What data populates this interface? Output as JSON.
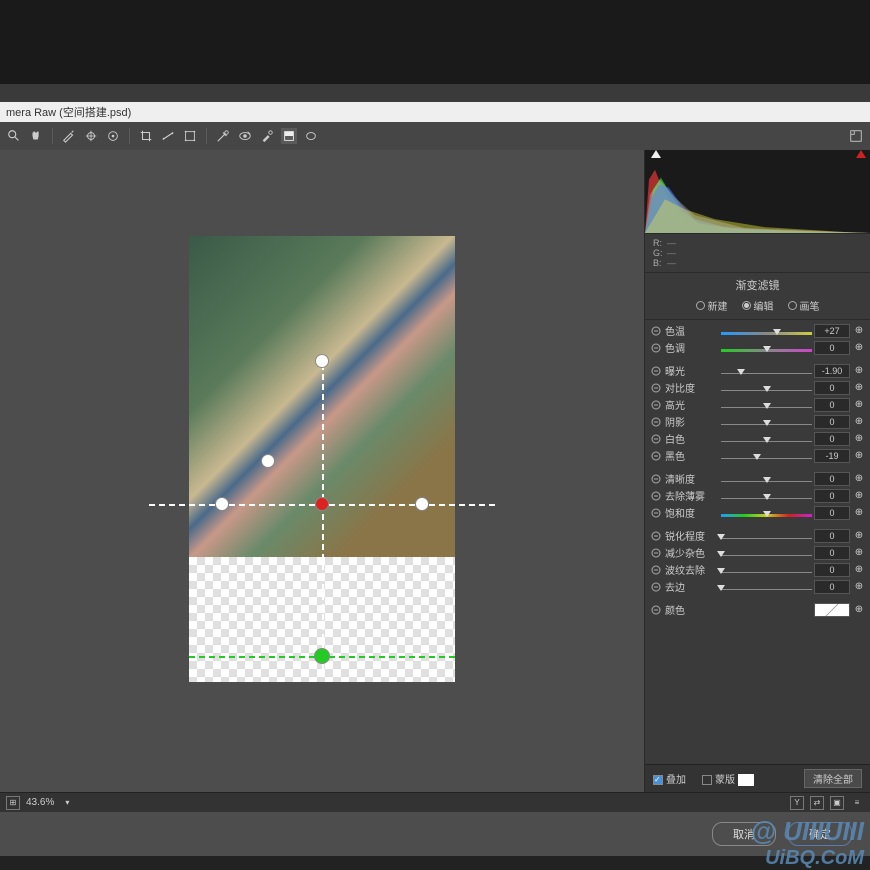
{
  "title": "mera Raw (空间搭建.psd)",
  "zoom_display": "43.6%",
  "rgb": {
    "r_label": "R:",
    "g_label": "G:",
    "b_label": "B:",
    "r": "—",
    "g": "—",
    "b": "—"
  },
  "panel_title": "渐变滤镜",
  "radios": {
    "new": "新建",
    "edit": "编辑",
    "brush": "画笔"
  },
  "sliders": {
    "temp": {
      "label": "色温",
      "value": "+27",
      "pos": 62
    },
    "tint": {
      "label": "色调",
      "value": "0",
      "pos": 50
    },
    "exposure": {
      "label": "曝光",
      "value": "-1.90",
      "pos": 22
    },
    "contrast": {
      "label": "对比度",
      "value": "0",
      "pos": 50
    },
    "highlights": {
      "label": "高光",
      "value": "0",
      "pos": 50
    },
    "shadows": {
      "label": "阴影",
      "value": "0",
      "pos": 50
    },
    "whites": {
      "label": "白色",
      "value": "0",
      "pos": 50
    },
    "blacks": {
      "label": "黑色",
      "value": "-19",
      "pos": 40
    },
    "clarity": {
      "label": "清晰度",
      "value": "0",
      "pos": 50
    },
    "dehaze": {
      "label": "去除薄雾",
      "value": "0",
      "pos": 50
    },
    "saturation": {
      "label": "饱和度",
      "value": "0",
      "pos": 50
    },
    "sharpness": {
      "label": "锐化程度",
      "value": "0",
      "pos": 0
    },
    "noise_lum": {
      "label": "减少杂色",
      "value": "0",
      "pos": 0
    },
    "noise_col": {
      "label": "波纹去除",
      "value": "0",
      "pos": 0
    },
    "defringe": {
      "label": "去边",
      "value": "0",
      "pos": 0
    },
    "color": {
      "label": "颜色"
    }
  },
  "footer": {
    "overlay": "叠加",
    "mask": "蒙版",
    "clear_all": "清除全部"
  },
  "buttons": {
    "cancel": "取消",
    "ok": "确定"
  },
  "bottom_right_icon": "Y",
  "watermark": {
    "l1": "@ UIIIUIII",
    "l2": "UiBQ.CoM"
  }
}
